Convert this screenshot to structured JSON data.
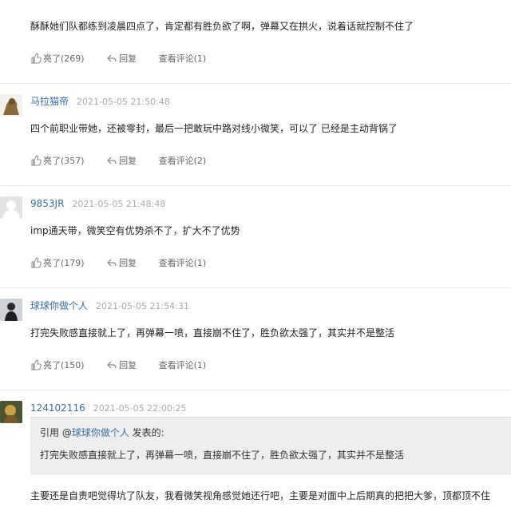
{
  "comments": [
    {
      "content": "酥酥她们队都练到凌晨四点了，肯定都有胜负欲了啊，弹幕又在拱火，说着话就控制不住了",
      "like_label": "亮了(269)",
      "reply_label": "回复",
      "view_label": "查看评论(1)"
    },
    {
      "username": "马拉猫帝",
      "time": "2021-05-05 21:50:48",
      "content": "四个前职业带她，还被零封，最后一把敢玩中路对线小微笑，可以了 已经是主动背锅了",
      "like_label": "亮了(357)",
      "reply_label": "回复",
      "view_label": "查看评论(2)"
    },
    {
      "username": "9853JR",
      "time": "2021-05-05 21:48:48",
      "content": "imp通天带，微笑空有优势杀不了，扩大不了优势",
      "like_label": "亮了(179)",
      "reply_label": "回复",
      "view_label": "查看评论(1)"
    },
    {
      "username": "球球你做个人",
      "time": "2021-05-05 21:54:31",
      "content": "打完失败感直接就上了，再弹幕一喷，直接崩不住了，胜负欲太强了，其实并不是整活",
      "like_label": "亮了(150)",
      "reply_label": "回复",
      "view_label": "查看评论(1)"
    },
    {
      "username": "124102116",
      "time": "2021-05-05 22:00:25",
      "quote": {
        "prefix": "引用 @",
        "user": "球球你做个人",
        "suffix": " 发表的:",
        "text": "打完失败感直接就上了，再弹幕一喷，直接崩不住了，胜负欲太强了，其实并不是整活"
      },
      "content": "主要还是自责吧觉得坑了队友，我看微笑视角感觉她还行吧，主要是对面中上后期真的把把大爹，顶都顶不住"
    }
  ],
  "icons": {
    "like": "thumbs-up-icon",
    "reply": "reply-arrow-icon"
  },
  "colors": {
    "username": "#3a6ea5",
    "quote_background": "#eeeeee",
    "divider": "#e6e6e6"
  }
}
